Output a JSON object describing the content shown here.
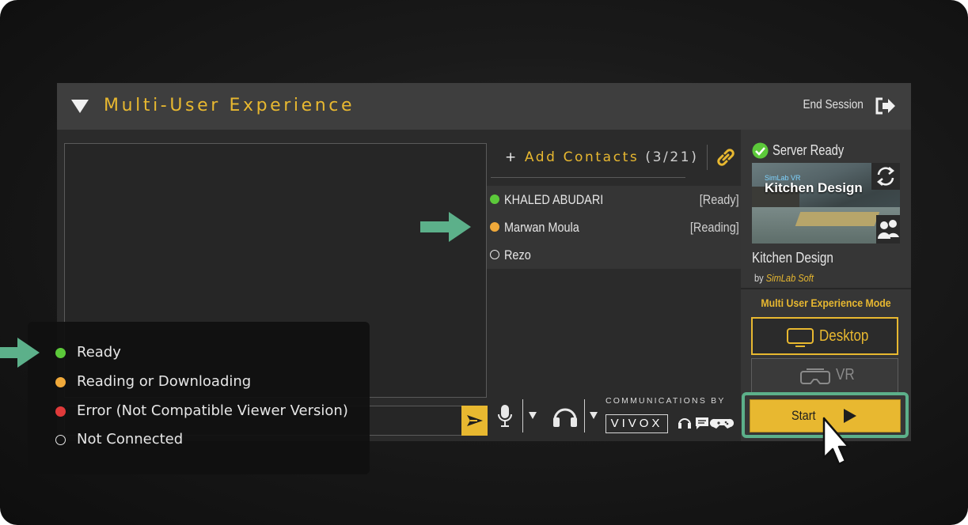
{
  "header": {
    "title": "Multi-User Experience",
    "end_session_label": "End Session"
  },
  "contacts_panel": {
    "add_contacts_label": "Add Contacts",
    "contacts_count": "(3/21)",
    "contacts": [
      {
        "name": "KHALED ABUDARI",
        "status": "[Ready]",
        "dot_color": "#5cc93a"
      },
      {
        "name": "Marwan Moula",
        "status": "[Reading]",
        "dot_color": "#f0a93a"
      },
      {
        "name": "Rezo",
        "status": "",
        "dot_color": "transparent"
      }
    ]
  },
  "voice": {
    "communications_by": "COMMUNICATIONS BY",
    "vivox_logo": "VIVOX"
  },
  "session": {
    "server_status": "Server Ready",
    "thumbnail_brand": "SimLab VR",
    "thumbnail_title": "Kitchen Design",
    "project_name": "Kitchen Design",
    "by_label": "by",
    "author": "SimLab Soft"
  },
  "mode": {
    "title": "Multi User Experience Mode",
    "desktop_label": "Desktop",
    "vr_label": "VR",
    "start_label": "Start"
  },
  "legend": [
    {
      "label": "Ready",
      "color": "#5cc93a"
    },
    {
      "label": "Reading or Downloading",
      "color": "#f0a93a"
    },
    {
      "label": "Error (Not Compatible Viewer Version)",
      "color": "#e03a3a"
    },
    {
      "label": "Not Connected",
      "color": "transparent"
    }
  ],
  "colors": {
    "accent": "#e8b830",
    "highlight": "#5cb08a"
  },
  "icons": [
    "collapse-triangle-icon",
    "exit-icon",
    "plus-icon",
    "link-icon",
    "send-icon",
    "microphone-icon",
    "headphones-icon",
    "sync-icon",
    "users-icon",
    "check-icon",
    "monitor-icon",
    "vr-headset-icon",
    "play-icon",
    "cursor-icon"
  ]
}
